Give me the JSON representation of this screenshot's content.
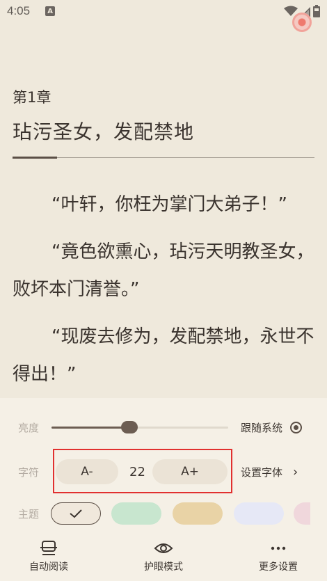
{
  "status_bar": {
    "time": "4:05",
    "badge": "A"
  },
  "reader": {
    "chapter_number": "第1章",
    "chapter_title": "玷污圣女，发配禁地",
    "paragraphs": [
      "“叶轩，你枉为掌门大弟子！”",
      "“竟色欲熏心，玷污天明教圣女，败坏本门清誉。”",
      "“现废去修为，发配禁地，永世不得出！”"
    ]
  },
  "settings": {
    "brightness": {
      "label": "亮度",
      "value": 0.44,
      "follow_system_label": "跟随系统",
      "follow_system": true
    },
    "font": {
      "label": "字符",
      "decrease_label": "A-",
      "size": "22",
      "increase_label": "A+",
      "set_font_label": "设置字体"
    },
    "theme": {
      "label": "主题",
      "swatches": [
        {
          "name": "beige",
          "color": "#f0e8dc",
          "selected": true
        },
        {
          "name": "green",
          "color": "#c8e6cf",
          "selected": false
        },
        {
          "name": "tan",
          "color": "#e9d3a6",
          "selected": false
        },
        {
          "name": "lavender",
          "color": "#e6e8f6",
          "selected": false
        },
        {
          "name": "pink-pattern",
          "color": "#f0d7dc",
          "selected": false
        }
      ]
    }
  },
  "bottom_nav": [
    {
      "label": "自动阅读",
      "icon": "auto-read-icon"
    },
    {
      "label": "护眼模式",
      "icon": "eye-icon"
    },
    {
      "label": "更多设置",
      "icon": "more-icon"
    }
  ],
  "colors": {
    "background": "#efe9dc",
    "panel": "#f5f0e6",
    "accent": "#6c5d52",
    "highlight_box": "#e1302f"
  }
}
